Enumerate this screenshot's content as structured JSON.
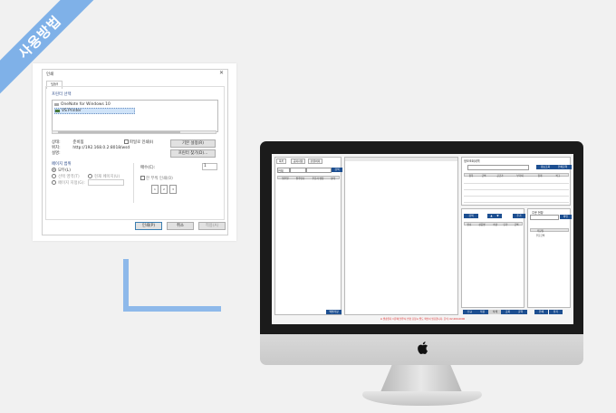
{
  "banner": {
    "text": "사용방법"
  },
  "print_dialog": {
    "title": "인쇄",
    "close_glyph": "✕",
    "tab": "일반",
    "printer_group_label": "프린터 선택",
    "printers": [
      "OneNote for Windows 10",
      "VS Printer"
    ],
    "status_label": "상태:",
    "status_value": "준비됨",
    "location_label": "위치:",
    "location_value": "http://192.168.0.2:8018/wsd",
    "comment_label": "설명:",
    "print_to_file_label": "파일로 인쇄(I)",
    "preferences_button": "기본 설정(R)",
    "find_printer_button": "프린터 찾기(D)...",
    "page_range_label": "페이지 범위",
    "range_all": "모두(L)",
    "range_selection": "선택 영역(T)",
    "range_current": "현재 페이지(U)",
    "range_pages": "페이지 지정(G):",
    "copies_label": "매수(C):",
    "copies_value": "1",
    "collate_label": "한 부씩 인쇄(O)",
    "collate_nums": [
      "1",
      "2",
      "3"
    ],
    "print_button": "인쇄(P)",
    "cancel_button": "취소",
    "apply_button": "적용(A)"
  },
  "app_screen": {
    "left_tabs": [
      "목록",
      "공지사항",
      "환불처리"
    ],
    "left_select": "전체",
    "left_search_button": "검색",
    "left_columns": [
      "발주일",
      "발주번호",
      "주문자 명칭",
      "상태"
    ],
    "left_bottom_button": "엑셀저장",
    "right_header_title": "정보조회내역",
    "right_buttons": [
      "정보조회",
      "인쇄출력"
    ],
    "right_columns": [
      "항목",
      "금액",
      "공급가",
      "부가세",
      "합계",
      "비고"
    ],
    "mid_section_buttons": [
      "검색",
      "▲",
      "▼",
      "추가"
    ],
    "mid_columns": [
      "번호",
      "상품명",
      "수량",
      "단가",
      "금액"
    ],
    "small_panel_title": "주문 현황",
    "small_panel_button": "확인",
    "small_columns": [
      "주문일",
      "주문금액"
    ],
    "bottom_buttons": [
      "신규",
      "저장",
      "삭제",
      "조회",
      "출력",
      "인쇄",
      "닫기"
    ],
    "status_text": "※ 발송일자 이후에 발주서 변경 요청시 별도 확인이 필요합니다. 문의: 02-000-0000"
  },
  "colors": {
    "ribbon": "#7fb1e8",
    "connector": "#8eb9ea",
    "accent": "#1d4f91"
  }
}
